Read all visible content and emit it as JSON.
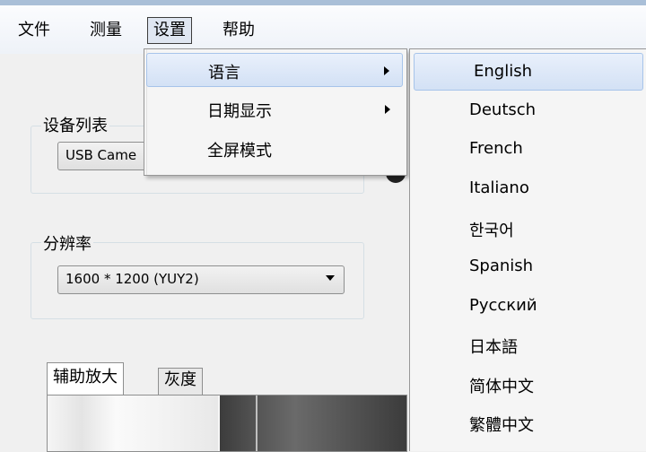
{
  "menubar": {
    "items": [
      {
        "label": "文件"
      },
      {
        "label": "测量"
      },
      {
        "label": "设置"
      },
      {
        "label": "帮助"
      }
    ]
  },
  "settings_menu": {
    "items": [
      {
        "label": "语言",
        "submenu": true
      },
      {
        "label": "日期显示",
        "submenu": true
      },
      {
        "label": "全屏模式",
        "submenu": false
      }
    ]
  },
  "language_menu": {
    "items": [
      "English",
      "Deutsch",
      "French",
      "Italiano",
      "한국어",
      "Spanish",
      "Русский",
      "日本語",
      "简体中文",
      "繁體中文"
    ]
  },
  "device_group": {
    "label": "设备列表",
    "selected": "USB Came"
  },
  "resolution_group": {
    "label": "分辨率",
    "selected": "1600 * 1200  (YUY2)"
  },
  "tabs": [
    {
      "label": "辅助放大"
    },
    {
      "label": "灰度"
    }
  ]
}
